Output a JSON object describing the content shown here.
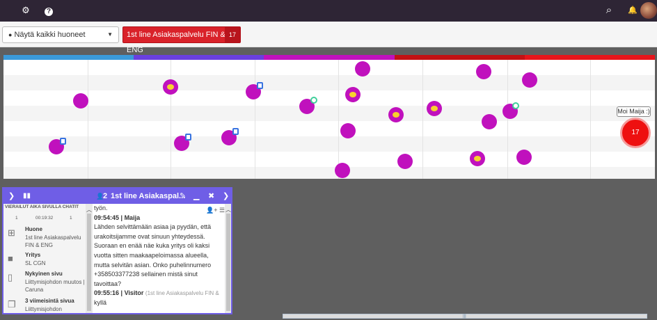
{
  "topbar": {
    "icons": [
      "gear-icon",
      "help-icon",
      "search-icon",
      "bell-icon",
      "avatar"
    ],
    "gear_glyph": "⚙",
    "help_glyph": "?",
    "search_glyph": "⌕",
    "bell_glyph": "🔔"
  },
  "toolbar": {
    "room_select": {
      "icon": "globe-icon",
      "value": "Näytä kaikki huoneet"
    },
    "queue_button": {
      "label": "1st line Asiakaspalvelu FIN & ENG",
      "count": "17"
    }
  },
  "visitor_map": {
    "colors": {
      "bar1": "#3b9ad9",
      "bar2": "#6a3fe0",
      "bar3": "#c011bd",
      "bar4": "#c31114",
      "bar5": "#e5151b",
      "visitor": "#c011bd",
      "active": "#ee1010"
    },
    "active_count": "17",
    "tooltip": "Moi Maija :)"
  },
  "chat": {
    "header": {
      "participants": "2",
      "title": "1st line Asiakaspal..."
    },
    "stats": {
      "headers": [
        "VIERAILUT",
        "AIKA SIVULLA",
        "CHATIT"
      ],
      "values": [
        "1",
        "00:19:32",
        "1"
      ]
    },
    "info": [
      {
        "icon": "sitemap-icon",
        "label": "Huone",
        "value": "1st line Asiakaspalvelu FIN & ENG"
      },
      {
        "icon": "briefcase-icon",
        "label": "Yritys",
        "value": "SL CGN"
      },
      {
        "icon": "document-icon",
        "label": "Nykyinen sivu",
        "value": "Liittymisjohdon muutos | Caruna"
      },
      {
        "icon": "pages-icon",
        "label": "3 viimeisintä sivua",
        "value": "Liittymisjohdon"
      }
    ],
    "messages": {
      "partial_top": "työn.",
      "m1_time": "09:54:45 |",
      "m1_name": "Maija",
      "m1_text": "Lähden selvittämään asiaa ja pyydän, että urakoitsijamme ovat sinuun yhteydessä. Suoraan en enää näe kuka yritys oli kaksi vuotta sitten maakaapeloimassa alueella, mutta selvitän asian. Onko puhelinnumero +358503377238 sellainen mistä sinut tavoittaa?",
      "m2_time": "09:55:16 |",
      "m2_name": "Visitor",
      "m2_room": "(1st line Asiakaspalvelu FIN &",
      "m2_text": "kyllä"
    }
  }
}
